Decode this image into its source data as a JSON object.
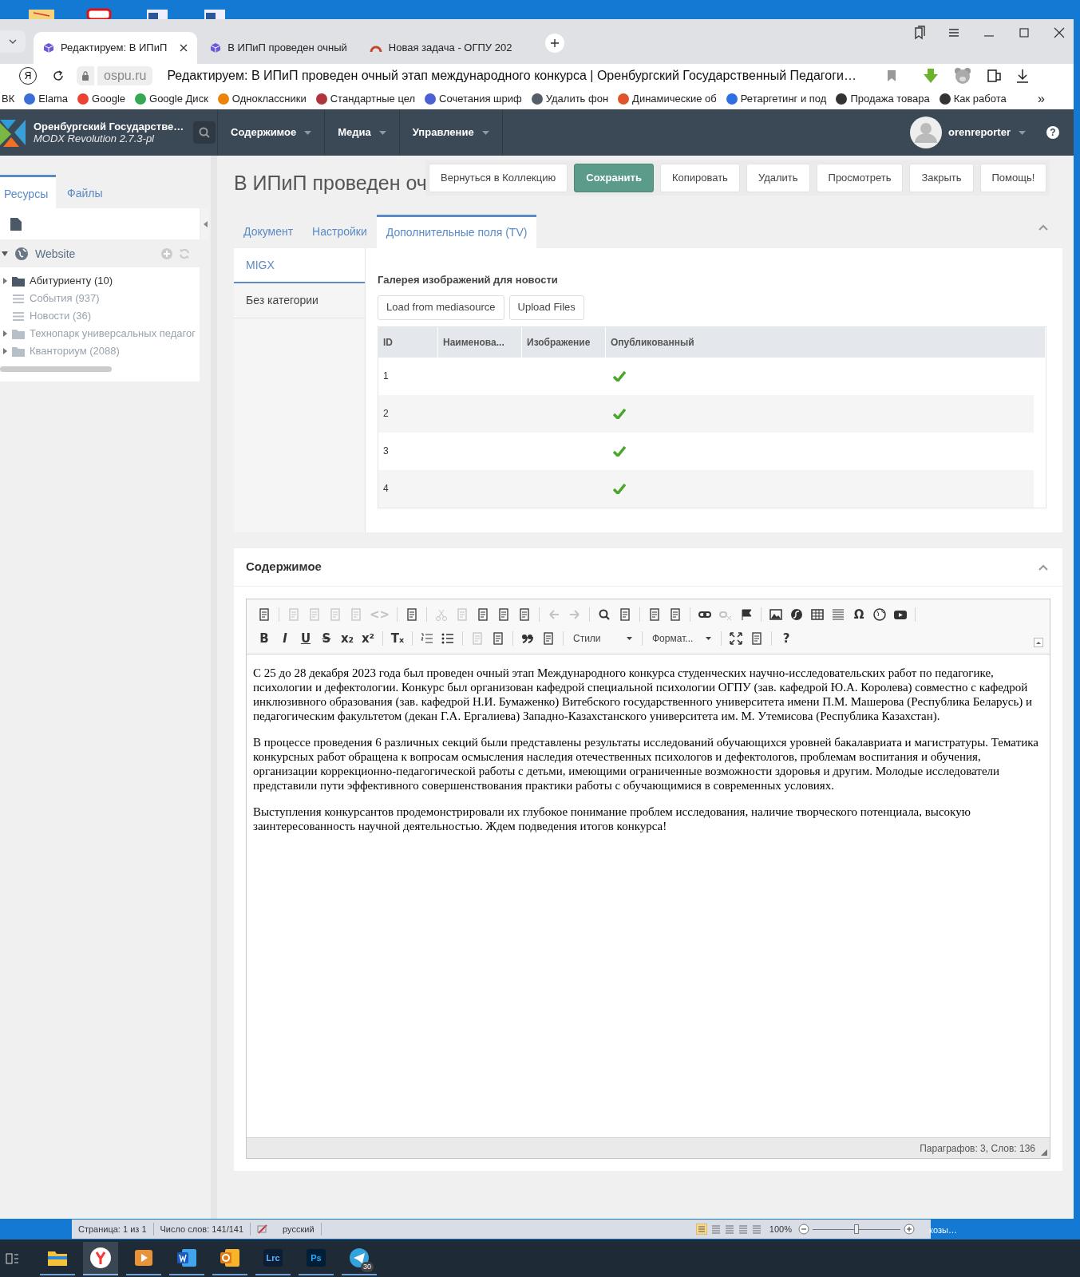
{
  "browser": {
    "tabs": [
      {
        "title": "Редактируем: В ИПиП",
        "selected": true,
        "kind": "cube",
        "closable": true
      },
      {
        "title": "В ИПиП проведен очный",
        "selected": false,
        "kind": "cube",
        "closable": false
      },
      {
        "title": "Новая задача - ОГПУ 202",
        "selected": false,
        "kind": "arc",
        "closable": false
      }
    ],
    "yandex_button": "Я",
    "domain": "ospu.ru",
    "page_title": "Редактируем: В ИПиП проведен очный этап международного конкурса | Оренбургский Государственный Педагоги…",
    "bookmarks": [
      {
        "label": "ВК"
      },
      {
        "label": "Elama",
        "color": "#3b6fd8"
      },
      {
        "label": "Google",
        "color": "#ea4335"
      },
      {
        "label": "Google Диск",
        "color": "#34a853"
      },
      {
        "label": "Одноклассники",
        "color": "#ee8208"
      },
      {
        "label": "Стандартные цел",
        "color": "#b0343c"
      },
      {
        "label": "Сочетания шриф",
        "color": "#4c5fd5"
      },
      {
        "label": "Удалить фон",
        "color": "#555e68"
      },
      {
        "label": "Динамические об",
        "color": "#e0542c"
      },
      {
        "label": "Ретаргетинг и под",
        "color": "#2f6fe4"
      },
      {
        "label": "Продажа товара",
        "color": "#333333"
      },
      {
        "label": "Как работа",
        "color": "#333333"
      }
    ],
    "bookmarks_more": "»"
  },
  "modx": {
    "site_name": "Оренбургский Государстве…",
    "version": "MODX Revolution 2.7.3-pl",
    "menu": [
      "Содержимое",
      "Медиа",
      "Управление"
    ],
    "user": "orenreporter",
    "help": "?"
  },
  "sidebar": {
    "tabs": [
      {
        "label": "Ресурсы",
        "selected": true
      },
      {
        "label": "Файлы",
        "selected": false
      }
    ],
    "root": "Website",
    "tree": [
      {
        "label": "Абитуриенту (10)",
        "kind": "folder",
        "dimmed": false
      },
      {
        "label": "События (937)",
        "kind": "list",
        "dimmed": true
      },
      {
        "label": "Новости (36)",
        "kind": "list",
        "dimmed": true
      },
      {
        "label": "Технопарк универсальных педагог",
        "kind": "folder",
        "dimmed": true
      },
      {
        "label": "Кванториум (2088)",
        "kind": "folder",
        "dimmed": true
      }
    ]
  },
  "page": {
    "title": "В ИПиП проведен оч",
    "actions": [
      {
        "label": "Вернуться в Коллекцию",
        "primary": false
      },
      {
        "label": "Сохранить",
        "primary": true
      },
      {
        "label": "Копировать",
        "primary": false
      },
      {
        "label": "Удалить",
        "primary": false
      },
      {
        "label": "Просмотреть",
        "primary": false
      },
      {
        "label": "Закрыть",
        "primary": false
      },
      {
        "label": "Помощь!",
        "primary": false
      }
    ],
    "tabs": [
      {
        "label": "Документ",
        "selected": false
      },
      {
        "label": "Настройки",
        "selected": false
      },
      {
        "label": "Дополнительные поля (TV)",
        "selected": true
      }
    ],
    "tv_categories": [
      {
        "label": "MIGX",
        "selected": true
      },
      {
        "label": "Без категории",
        "selected": false
      }
    ],
    "gallery": {
      "label": "Галерея изображений для новости",
      "buttons": [
        "Load from mediasource",
        "Upload Files"
      ],
      "columns": [
        "ID",
        "Наименова...",
        "Изображение",
        "Опубликованный"
      ],
      "rows": [
        {
          "id": "1",
          "published": true
        },
        {
          "id": "2",
          "published": true
        },
        {
          "id": "3",
          "published": true
        },
        {
          "id": "4",
          "published": true
        }
      ]
    }
  },
  "content": {
    "title": "Содержимое",
    "toolbar": [
      [
        {
          "kind": "icon",
          "disabled": false
        },
        {
          "kind": "sep"
        },
        {
          "kind": "icon",
          "disabled": true
        },
        {
          "kind": "icon",
          "disabled": true
        },
        {
          "kind": "icon",
          "disabled": true
        },
        {
          "kind": "icon",
          "disabled": true
        },
        {
          "kind": "glyph",
          "text": "<>",
          "disabled": true
        },
        {
          "kind": "sep"
        },
        {
          "kind": "icon",
          "disabled": false
        },
        {
          "kind": "sep"
        },
        {
          "kind": "icon",
          "disabled": true
        },
        {
          "kind": "icon",
          "disabled": true
        },
        {
          "kind": "icon",
          "disabled": false
        },
        {
          "kind": "icon",
          "disabled": false
        },
        {
          "kind": "icon",
          "disabled": false
        },
        {
          "kind": "sep"
        },
        {
          "kind": "icon",
          "disabled": true
        },
        {
          "kind": "icon",
          "disabled": true
        },
        {
          "kind": "sep"
        },
        {
          "kind": "icon",
          "disabled": false
        },
        {
          "kind": "icon",
          "disabled": false
        },
        {
          "kind": "sep"
        },
        {
          "kind": "icon",
          "disabled": false
        },
        {
          "kind": "icon",
          "disabled": false
        },
        {
          "kind": "sep"
        },
        {
          "kind": "icon",
          "disabled": false
        },
        {
          "kind": "icon",
          "disabled": true
        },
        {
          "kind": "icon",
          "disabled": false
        },
        {
          "kind": "sep"
        },
        {
          "kind": "icon",
          "disabled": false
        },
        {
          "kind": "icon",
          "disabled": false
        },
        {
          "kind": "icon",
          "disabled": false
        },
        {
          "kind": "icon",
          "disabled": false
        },
        {
          "kind": "glyph",
          "text": "Ω",
          "disabled": false
        },
        {
          "kind": "icon",
          "disabled": false
        },
        {
          "kind": "icon",
          "disabled": false
        },
        {
          "kind": "sep"
        }
      ],
      [
        {
          "kind": "glyph",
          "text": "B",
          "disabled": false
        },
        {
          "kind": "glyph",
          "text": "I",
          "disabled": false
        },
        {
          "kind": "glyph",
          "text": "U",
          "disabled": false
        },
        {
          "kind": "glyph",
          "text": "S",
          "disabled": false
        },
        {
          "kind": "glyph",
          "text": "x₂",
          "disabled": false
        },
        {
          "kind": "glyph",
          "text": "x²",
          "disabled": false
        },
        {
          "kind": "sep"
        },
        {
          "kind": "glyph",
          "text": "Tₓ",
          "disabled": false
        },
        {
          "kind": "sep"
        },
        {
          "kind": "icon",
          "disabled": false
        },
        {
          "kind": "icon",
          "disabled": false
        },
        {
          "kind": "sep"
        },
        {
          "kind": "icon",
          "disabled": true
        },
        {
          "kind": "icon",
          "disabled": false
        },
        {
          "kind": "sep"
        },
        {
          "kind": "icon",
          "disabled": false
        },
        {
          "kind": "icon",
          "disabled": false
        },
        {
          "kind": "sep"
        },
        {
          "kind": "dropdown",
          "text": "Стили",
          "disabled": false
        },
        {
          "kind": "sep"
        },
        {
          "kind": "dropdown",
          "text": "Формат...",
          "disabled": false
        },
        {
          "kind": "sep"
        },
        {
          "kind": "icon",
          "disabled": false
        },
        {
          "kind": "icon",
          "disabled": false
        },
        {
          "kind": "sep"
        },
        {
          "kind": "glyph",
          "text": "?",
          "disabled": false
        }
      ]
    ],
    "paragraphs": [
      "С 25 до 28 декабря 2023 года был проведен очный этап Международного конкурса студенческих научно-исследовательских работ по педагогике, психологии и дефектологии. Конкурс был организован кафедрой специальной психологии ОГПУ (зав. кафедрой Ю.А. Королева) совместно с кафедрой инклюзивного образования (зав. кафедрой Н.И. Бумаженко) Витебского государственного университета имени П.М. Машерова (Республика Беларусь) и педагогическим факультетом (декан Г.А. Ергалиева) Западно-Казахстанского университета им. М. Утемисова (Республика Казахстан).",
      "В процессе проведения 6 различных секций были представлены результаты исследований обучающихся уровней бакалавриата и магистратуры. Тематика конкурсных работ обращена к вопросам осмысления наследия отечественных психологов и дефектологов, проблемам воспитания и обучения, организации коррекционно-педагогической работы с детьми, имеющими ограниченные возможности здоровья и другим. Молодые исследователи представили пути эффективного совершенствования практики работы с обучающимися в современных условиях.",
      "Выступления конкурсантов продемонстрировали их глубокое понимание проблем исследования, наличие творческого потенциала, высокую заинтересованность научной деятельностью. Ждем подведения итогов конкурса!"
    ],
    "status": "Параграфов: 3, Слов: 136"
  },
  "word_status": {
    "page": "Страница: 1 из 1",
    "words": "Число слов: 141/141",
    "language": "русский",
    "zoom": "100%",
    "zoom_slider": {
      "level": 0.5
    }
  },
  "desktop_label": "козы…",
  "taskbar": [
    {
      "kind": "explorer",
      "active": false
    },
    {
      "kind": "yandex",
      "active": true
    },
    {
      "kind": "video",
      "active": false
    },
    {
      "kind": "word",
      "active": false
    },
    {
      "kind": "outlook",
      "active": false
    },
    {
      "kind": "lightroom",
      "active": false,
      "label": "Lrc"
    },
    {
      "kind": "photoshop",
      "active": false,
      "label": "Ps"
    },
    {
      "kind": "telegram",
      "active": false,
      "badge": "30"
    }
  ]
}
